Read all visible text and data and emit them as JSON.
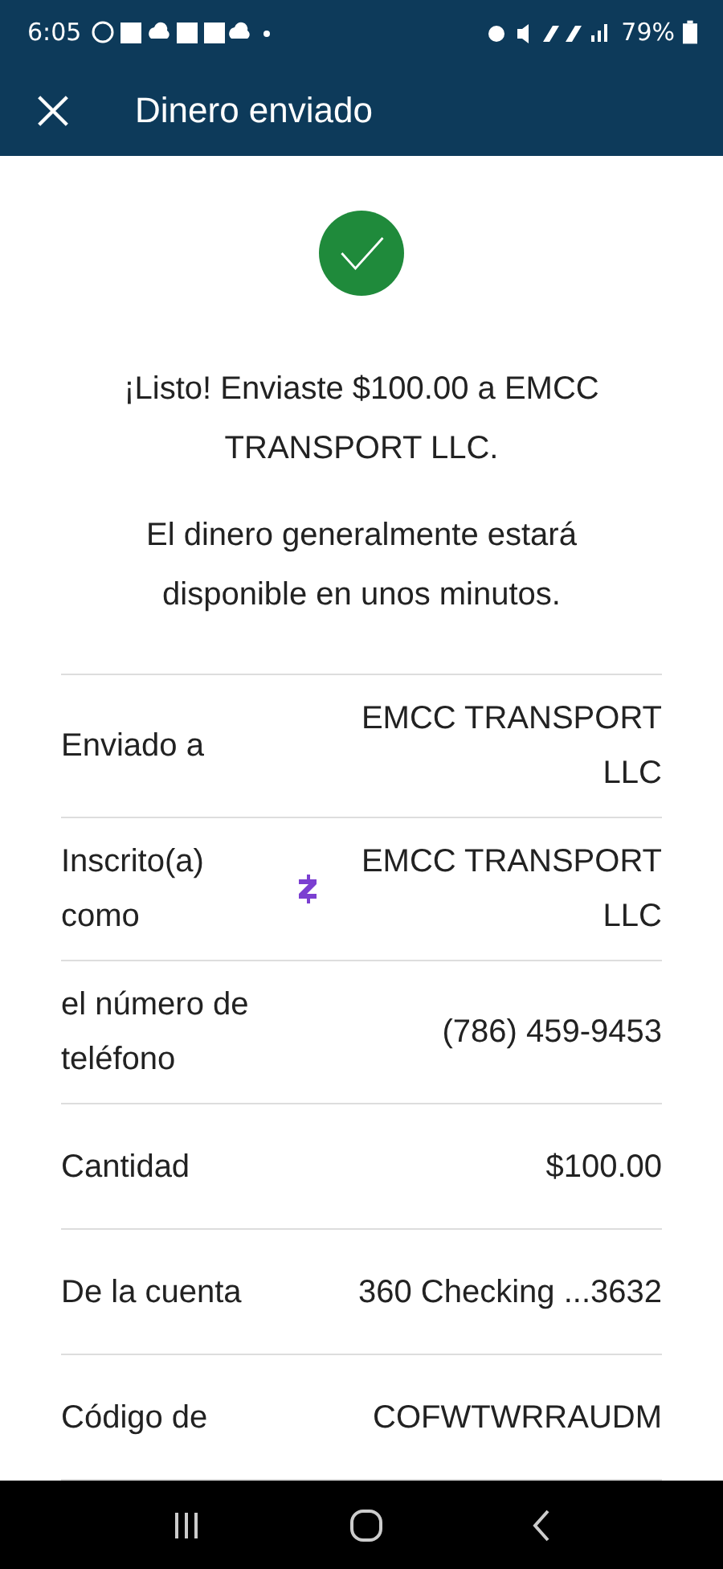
{
  "status_bar": {
    "time": "6:05",
    "battery": "79%"
  },
  "app_bar": {
    "title": "Dinero enviado"
  },
  "message": {
    "lines": [
      "¡Listo! Enviaste $100.00 a EMCC TRANSPORT LLC.",
      "El dinero generalmente estará disponible en unos minutos."
    ]
  },
  "details": [
    {
      "label": "Enviado a",
      "value": "EMCC TRANSPORT LLC",
      "zelle": false
    },
    {
      "label": "Inscrito(a) como",
      "value": "EMCC TRANSPORT LLC",
      "zelle": true
    },
    {
      "label": "el número de teléfono",
      "value": "(786) 459-9453",
      "zelle": false
    },
    {
      "label": "Cantidad",
      "value": "$100.00",
      "zelle": false
    },
    {
      "label": "De la cuenta",
      "value": "360 Checking ...3632",
      "zelle": false
    },
    {
      "label": "Código de",
      "value": "COFWTWRRAUDM",
      "zelle": false
    }
  ]
}
